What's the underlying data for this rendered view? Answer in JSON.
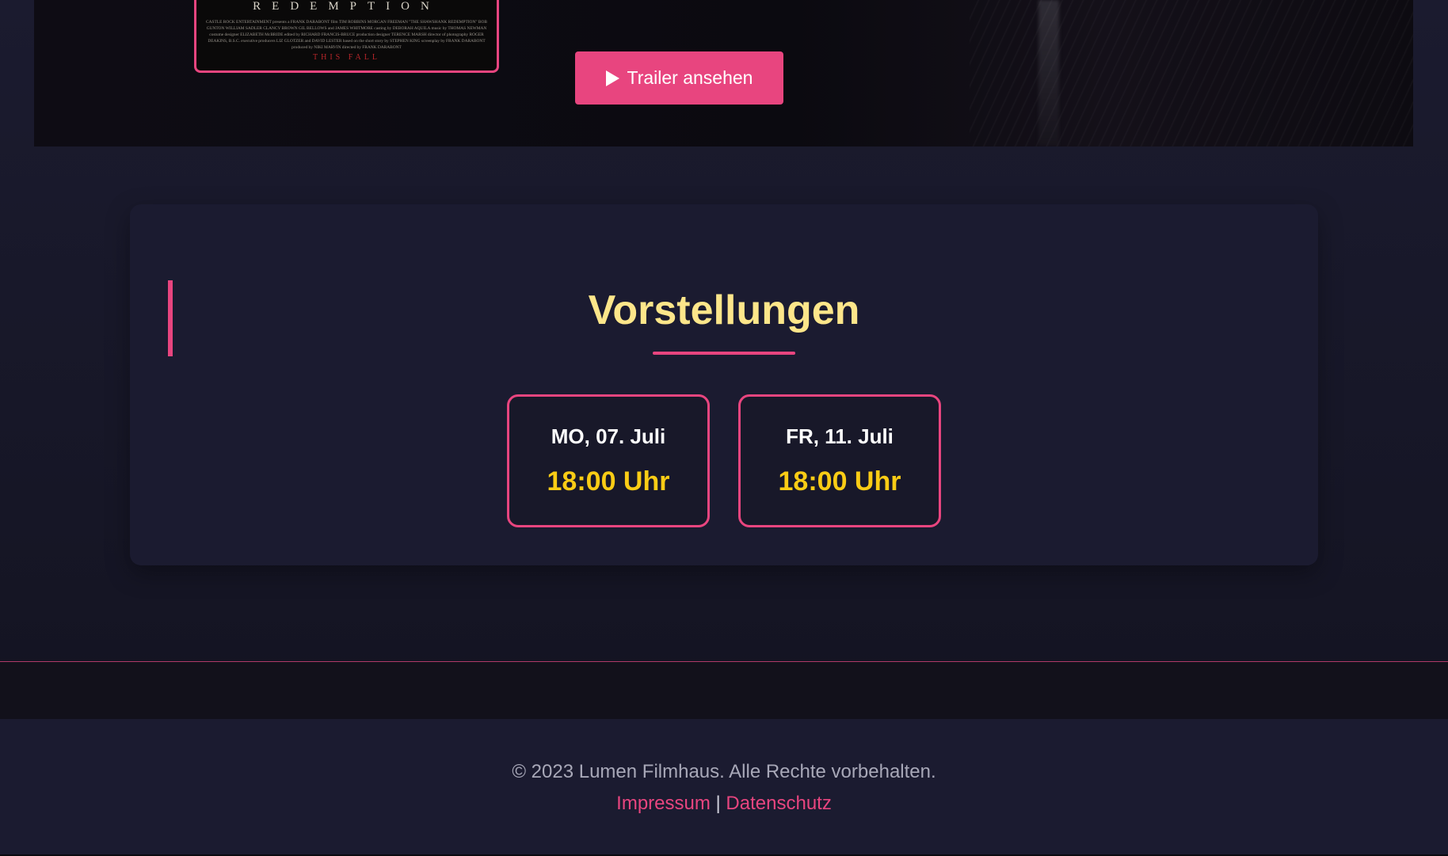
{
  "poster": {
    "title": "REDEMPTION",
    "credits": "CASTLE ROCK ENTERTAINMENT presents a FRANK DARABONT film TIM ROBBINS MORGAN FREEMAN \"THE SHAWSHANK REDEMPTION\" BOB GUNTON WILLIAM SADLER CLANCY BROWN GIL BELLOWS and JAMES WHITMORE casting by DEBORAH AQUILA music by THOMAS NEWMAN costume designer ELIZABETH McBRIDE edited by RICHARD FRANCIS-BRUCE production designer TERENCE MARSH director of photography ROGER DEAKINS, B.S.C. executive producers LIZ GLOTZER and DAVID LESTER based on the short story by STEPHEN KING screenplay by FRANK DARABONT produced by NIKI MARVIN directed by FRANK DARABONT",
    "tagline": "THIS FALL",
    "accent_color": "#e8457f"
  },
  "hero": {
    "trailer_button_label": "Trailer ansehen",
    "trailer_icon": "play-icon"
  },
  "showtimes": {
    "title": "Vorstellungen",
    "items": [
      {
        "day": "MO, 07. Juli",
        "time": "18:00 Uhr"
      },
      {
        "day": "FR, 11. Juli",
        "time": "18:00 Uhr"
      }
    ]
  },
  "footer": {
    "copyright": "© 2023 Lumen Filmhaus. Alle Rechte vorbehalten.",
    "links": [
      "Impressum",
      "Datenschutz"
    ],
    "separator": "|"
  },
  "colors": {
    "accent": "#e8457f",
    "title_yellow": "#fde68a",
    "time_yellow": "#facc15",
    "background": "#1b1b30"
  }
}
